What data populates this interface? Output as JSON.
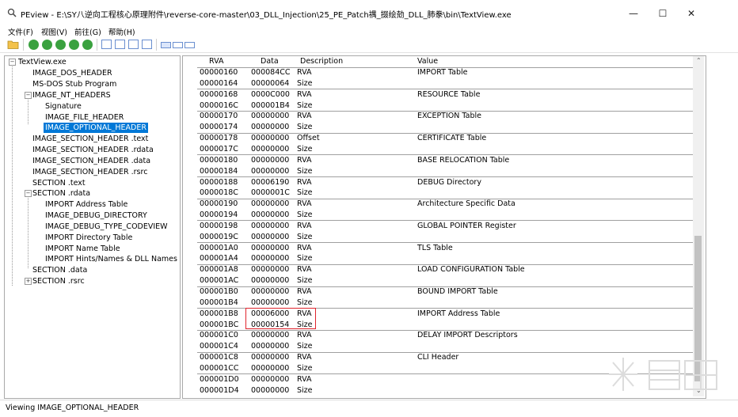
{
  "window": {
    "title": "PEview - E:\\SY八逆向工程核心原理附件\\reverse-core-master\\03_DLL_Injection\\25_PE_Patch禑_掇绘勀_DLL_肺豢\\bin\\TextView.exe",
    "minimize": "—",
    "maximize": "☐",
    "close": "✕"
  },
  "menu": {
    "items": [
      "文件(F)",
      "视图(V)",
      "前往(G)",
      "帮助(H)"
    ]
  },
  "tree": {
    "items": [
      {
        "label": "TextView.exe"
      },
      {
        "label": "IMAGE_DOS_HEADER"
      },
      {
        "label": "MS-DOS Stub Program"
      },
      {
        "label": "IMAGE_NT_HEADERS"
      },
      {
        "label": "Signature"
      },
      {
        "label": "IMAGE_FILE_HEADER"
      },
      {
        "label": "IMAGE_OPTIONAL_HEADER"
      },
      {
        "label": "IMAGE_SECTION_HEADER .text"
      },
      {
        "label": "IMAGE_SECTION_HEADER .rdata"
      },
      {
        "label": "IMAGE_SECTION_HEADER .data"
      },
      {
        "label": "IMAGE_SECTION_HEADER .rsrc"
      },
      {
        "label": "SECTION .text"
      },
      {
        "label": "SECTION .rdata"
      },
      {
        "label": "IMPORT Address Table"
      },
      {
        "label": "IMAGE_DEBUG_DIRECTORY"
      },
      {
        "label": "IMAGE_DEBUG_TYPE_CODEVIEW"
      },
      {
        "label": "IMPORT Directory Table"
      },
      {
        "label": "IMPORT Name Table"
      },
      {
        "label": "IMPORT Hints/Names & DLL Names"
      },
      {
        "label": "SECTION .data"
      },
      {
        "label": "SECTION .rsrc"
      }
    ]
  },
  "grid": {
    "headers": {
      "rva": "RVA",
      "data": "Data",
      "description": "Description",
      "value": "Value"
    },
    "rows": [
      {
        "rva": "00000160",
        "data": "000084CC",
        "desc": "RVA",
        "value": "IMPORT Table"
      },
      {
        "rva": "00000164",
        "data": "00000064",
        "desc": "Size",
        "value": ""
      },
      {
        "rva": "00000168",
        "data": "0000C000",
        "desc": "RVA",
        "value": "RESOURCE Table"
      },
      {
        "rva": "0000016C",
        "data": "000001B4",
        "desc": "Size",
        "value": ""
      },
      {
        "rva": "00000170",
        "data": "00000000",
        "desc": "RVA",
        "value": "EXCEPTION Table"
      },
      {
        "rva": "00000174",
        "data": "00000000",
        "desc": "Size",
        "value": ""
      },
      {
        "rva": "00000178",
        "data": "00000000",
        "desc": "Offset",
        "value": "CERTIFICATE Table"
      },
      {
        "rva": "0000017C",
        "data": "00000000",
        "desc": "Size",
        "value": ""
      },
      {
        "rva": "00000180",
        "data": "00000000",
        "desc": "RVA",
        "value": "BASE RELOCATION Table"
      },
      {
        "rva": "00000184",
        "data": "00000000",
        "desc": "Size",
        "value": ""
      },
      {
        "rva": "00000188",
        "data": "00006190",
        "desc": "RVA",
        "value": "DEBUG Directory"
      },
      {
        "rva": "0000018C",
        "data": "0000001C",
        "desc": "Size",
        "value": ""
      },
      {
        "rva": "00000190",
        "data": "00000000",
        "desc": "RVA",
        "value": "Architecture Specific Data"
      },
      {
        "rva": "00000194",
        "data": "00000000",
        "desc": "Size",
        "value": ""
      },
      {
        "rva": "00000198",
        "data": "00000000",
        "desc": "RVA",
        "value": "GLOBAL POINTER Register"
      },
      {
        "rva": "0000019C",
        "data": "00000000",
        "desc": "Size",
        "value": ""
      },
      {
        "rva": "000001A0",
        "data": "00000000",
        "desc": "RVA",
        "value": "TLS Table"
      },
      {
        "rva": "000001A4",
        "data": "00000000",
        "desc": "Size",
        "value": ""
      },
      {
        "rva": "000001A8",
        "data": "00000000",
        "desc": "RVA",
        "value": "LOAD CONFIGURATION Table"
      },
      {
        "rva": "000001AC",
        "data": "00000000",
        "desc": "Size",
        "value": ""
      },
      {
        "rva": "000001B0",
        "data": "00000000",
        "desc": "RVA",
        "value": "BOUND IMPORT Table"
      },
      {
        "rva": "000001B4",
        "data": "00000000",
        "desc": "Size",
        "value": ""
      },
      {
        "rva": "000001B8",
        "data": "00006000",
        "desc": "RVA",
        "value": "IMPORT Address Table"
      },
      {
        "rva": "000001BC",
        "data": "00000154",
        "desc": "Size",
        "value": ""
      },
      {
        "rva": "000001C0",
        "data": "00000000",
        "desc": "RVA",
        "value": "DELAY IMPORT Descriptors"
      },
      {
        "rva": "000001C4",
        "data": "00000000",
        "desc": "Size",
        "value": ""
      },
      {
        "rva": "000001C8",
        "data": "00000000",
        "desc": "RVA",
        "value": "CLI Header"
      },
      {
        "rva": "000001CC",
        "data": "00000000",
        "desc": "Size",
        "value": ""
      },
      {
        "rva": "000001D0",
        "data": "00000000",
        "desc": "RVA",
        "value": ""
      },
      {
        "rva": "000001D4",
        "data": "00000000",
        "desc": "Size",
        "value": ""
      }
    ]
  },
  "status": {
    "text": "Viewing IMAGE_OPTIONAL_HEADER"
  },
  "colors": {
    "selection": "#0078d7",
    "highlight_box": "#e0242d"
  }
}
